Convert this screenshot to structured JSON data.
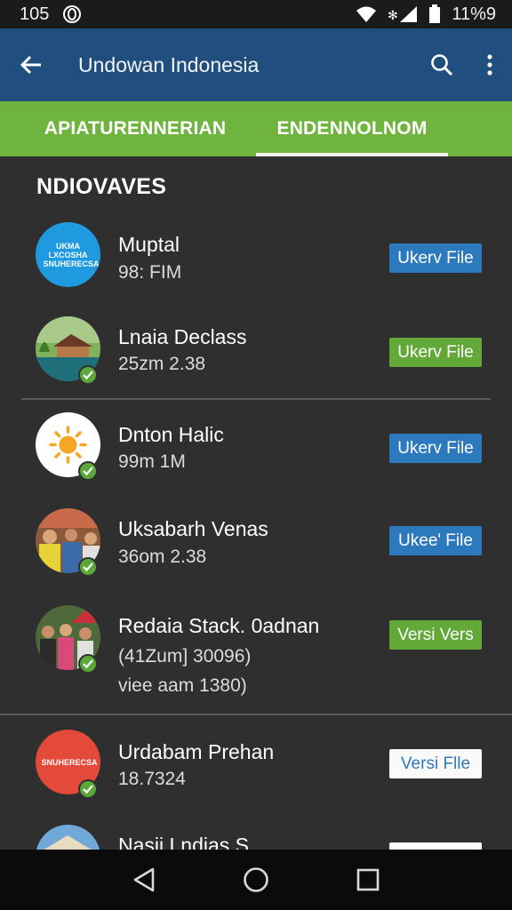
{
  "status": {
    "left_number": "105",
    "time": "11%9"
  },
  "app_bar": {
    "title": "Undowan Indonesia",
    "back_icon": "back-arrow-icon",
    "search_icon": "search-icon",
    "menu_icon": "more-vert-icon",
    "color": "#1f4e7f"
  },
  "tabs": [
    {
      "label": "APIATURENNERIAN"
    },
    {
      "label": "ENDENNOLNOM",
      "selected": true
    }
  ],
  "section": {
    "title": "NDIOVAVES"
  },
  "items": [
    {
      "title": "Muptal",
      "sub1": "98: FIM",
      "button": "Ukerv File",
      "avatar_text": "UKMA LXCOSHA SNUHERECSA"
    },
    {
      "title": "Lnaia Declass",
      "sub1": "25zm 2.38",
      "button": "Ukerv File"
    },
    {
      "title": "Dnton Halic",
      "sub1": "99m 1M",
      "button": "Ukerv File"
    },
    {
      "title": "Uksabarh Venas",
      "sub1": "36om 2.38",
      "button": "Ukee' File"
    },
    {
      "title": "Redaia Stack. 0adnan",
      "sub1": "(41Zum] 30096)",
      "sub2": "viee aam 1380)",
      "button": "Versi Vers"
    },
    {
      "title": "Urdabam Prehan",
      "sub1": "18.7324",
      "button": "Versi Flle",
      "avatar_text": "SNUHERECSA"
    },
    {
      "title": "Nasii Lndias S"
    }
  ],
  "colors": {
    "green": "#6fb43f",
    "blue_button": "#2d79be",
    "green_button": "#62a93a",
    "check": "#5aa83a"
  }
}
